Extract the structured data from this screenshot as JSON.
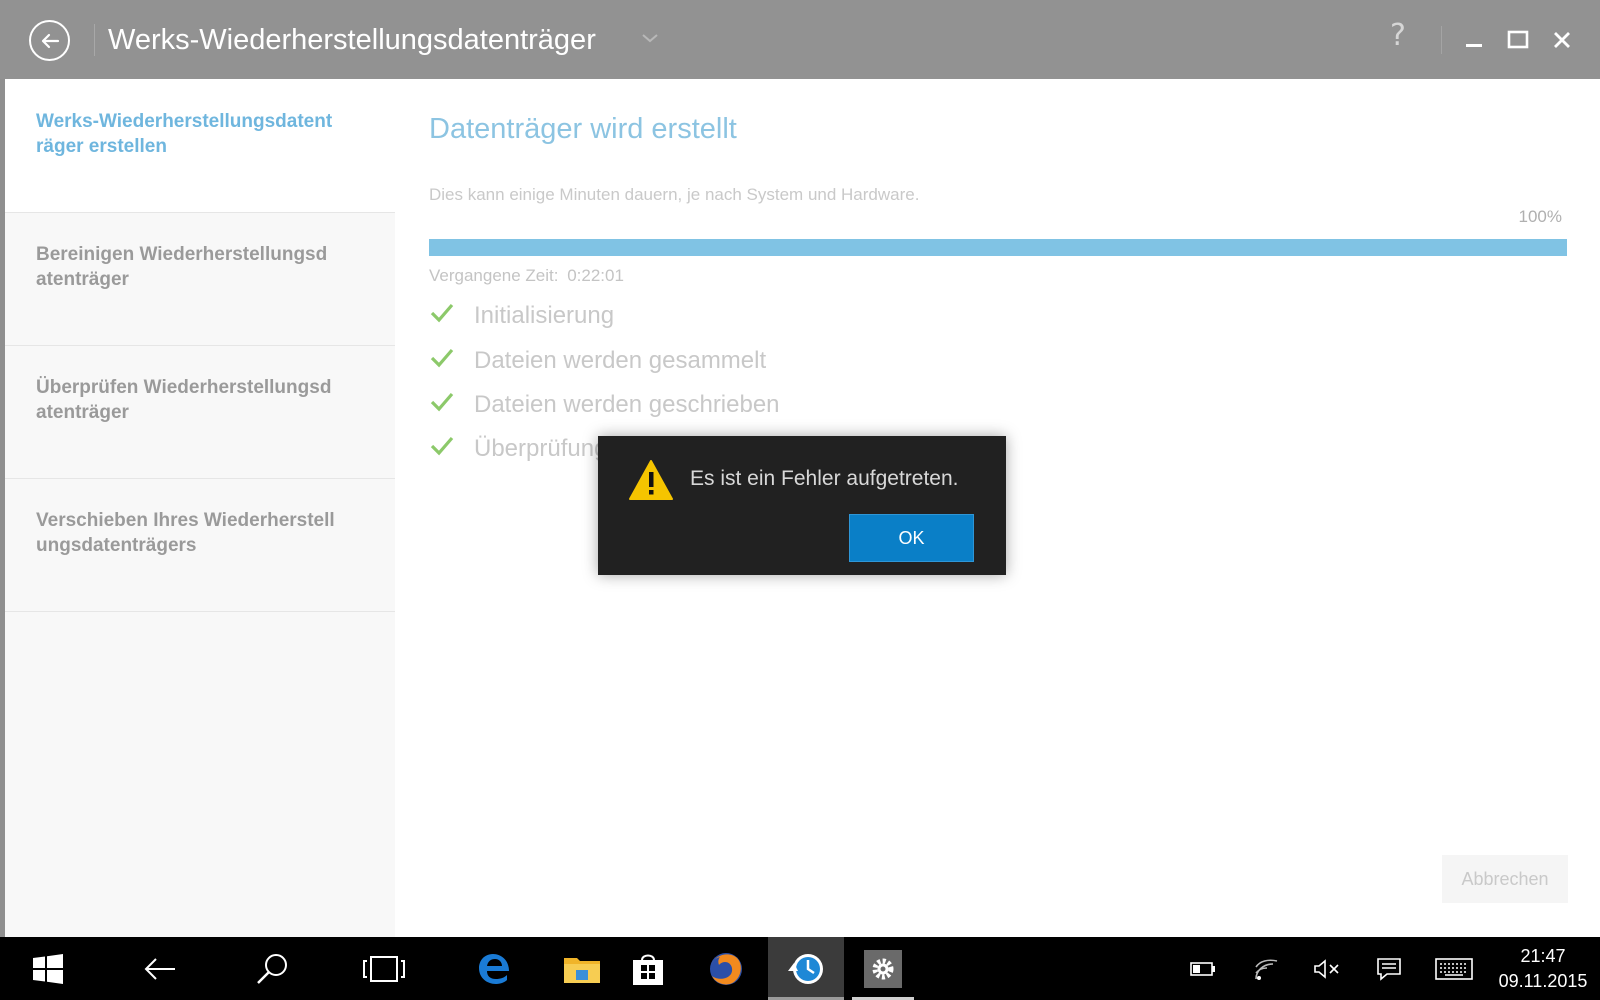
{
  "window": {
    "title": "Werks-Wiederherstellungsdatenträger",
    "help_label": "?"
  },
  "sidebar": {
    "items": [
      {
        "label": "Werks-Wiederherstellungsdatenträger erstellen",
        "active": true
      },
      {
        "label": "Bereinigen Wiederherstellungsdatenträger",
        "active": false
      },
      {
        "label": "Überprüfen Wiederherstellungsdatenträger",
        "active": false
      },
      {
        "label": "Verschieben Ihres Wiederherstellungsdatenträgers",
        "active": false
      }
    ]
  },
  "main": {
    "title": "Datenträger wird erstellt",
    "description": "Dies kann einige Minuten dauern, je nach System und Hardware.",
    "progress_label": "100%",
    "progress_value": 1.0,
    "elapsed_label": "Vergangene Zeit:",
    "elapsed_value": "0:22:01",
    "steps": [
      {
        "label": "Initialisierung",
        "done": true
      },
      {
        "label": "Dateien werden gesammelt",
        "done": true
      },
      {
        "label": "Dateien werden geschrieben",
        "done": true
      },
      {
        "label": "Überprüfung",
        "done": true
      }
    ],
    "cancel_label": "Abbrechen"
  },
  "dialog": {
    "message": "Es ist ein Fehler aufgetreten.",
    "ok_label": "OK",
    "icon": "warning-icon"
  },
  "taskbar": {
    "apps": [
      "windows-start-icon",
      "back-icon",
      "search-icon",
      "task-view-icon",
      "edge-icon",
      "file-explorer-icon",
      "store-icon",
      "firefox-icon",
      "recovery-app-icon",
      "settings-icon"
    ],
    "tray": [
      "battery-icon",
      "wifi-icon",
      "volume-muted-icon",
      "action-center-icon",
      "keyboard-icon"
    ],
    "time": "21:47",
    "date": "09.11.2015"
  },
  "colors": {
    "accent": "#80c3e4",
    "titlebar": "#929292",
    "check": "#8cc96a",
    "dialog_button": "#0a7fc7",
    "warning": "#f5c400"
  }
}
